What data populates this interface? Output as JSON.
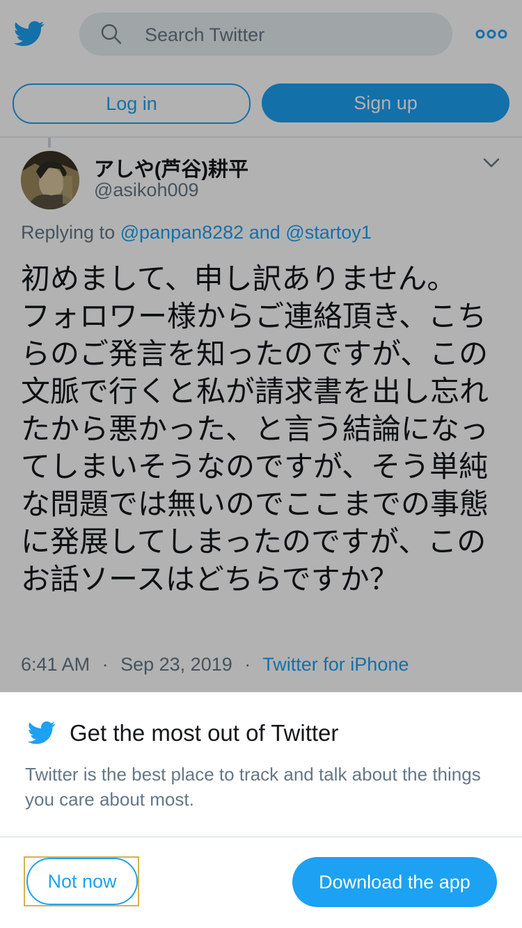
{
  "header": {
    "logo_icon": "twitter-bird-icon",
    "search_placeholder": "Search Twitter",
    "more_icon": "more-dots-icon",
    "login_label": "Log in",
    "signup_label": "Sign up"
  },
  "tweet": {
    "display_name": "アしや(芦谷)耕平",
    "handle": "@asikoh009",
    "replying_prefix": "Replying to",
    "reply_user_1": "@panpan8282",
    "reply_and": "and",
    "reply_user_2": "@startoy1",
    "text": "初めまして、申し訳ありません。\nフォロワー様からご連絡頂き、こちらのご発言を知ったのですが、この文脈で行くと私が請求書を出し忘れたから悪かった、と言う結論になってしまいそうなのですが、そう単純な問題では無いのでここまでの事態に発展してしまったのですが、このお話ソースはどちらですか？",
    "time": "6:41 AM",
    "date": "Sep 23, 2019",
    "separator": "·",
    "source": "Twitter for iPhone"
  },
  "sheet": {
    "title": "Get the most out of Twitter",
    "description": "Twitter is the best place to track and talk about the things you care about most.",
    "not_now_label": "Not now",
    "download_label": "Download the app"
  },
  "colors": {
    "brand_blue": "#1da1f2",
    "text_primary": "#14171a",
    "text_secondary": "#657786",
    "search_bg": "#e6ecf0",
    "focus_outline": "#d4b24a"
  }
}
